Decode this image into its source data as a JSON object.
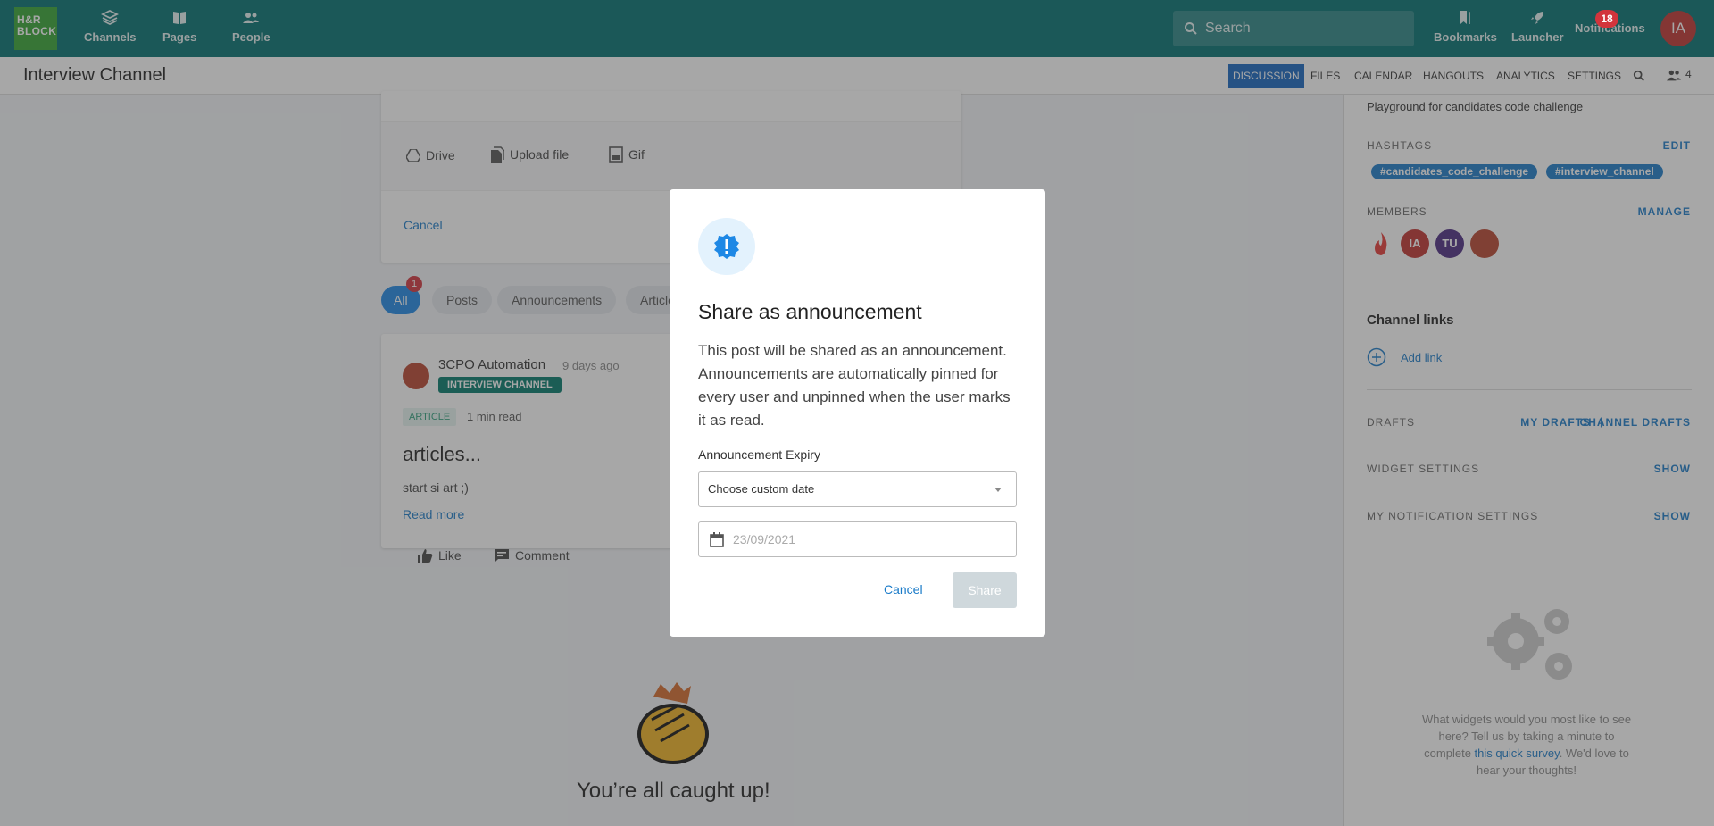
{
  "topbar": {
    "logo_text": "H&R BLOCK",
    "nav": [
      "Channels",
      "Pages",
      "People"
    ],
    "search_placeholder": "Search",
    "right": [
      "Bookmarks",
      "Launcher",
      "Notifications"
    ],
    "notifications_count": "18",
    "user_initials": "IA"
  },
  "channel": {
    "title": "Interview Channel",
    "tabs": [
      "DISCUSSION",
      "FILES",
      "CALENDAR",
      "HANGOUTS",
      "ANALYTICS",
      "SETTINGS"
    ],
    "member_count": "4"
  },
  "composer": {
    "actions": [
      "Drive",
      "Upload file",
      "Gif"
    ],
    "cancel": "Cancel"
  },
  "filters": {
    "items": [
      "All",
      "Posts",
      "Announcements",
      "Articles"
    ],
    "all_badge": "1"
  },
  "post": {
    "author": "3CPO Automation",
    "time": "9 days ago",
    "channel_tag": "INTERVIEW CHANNEL",
    "type": "ARTICLE",
    "read_time": "1 min read",
    "title": "articles...",
    "body": "start si art ;)",
    "read_more": "Read more",
    "like": "Like",
    "comment": "Comment"
  },
  "caught_up": "You’re all caught up!",
  "sidebar": {
    "description": "Playground for candidates code challenge",
    "hashtags_label": "HASHTAGS",
    "edit": "EDIT",
    "hashtags": [
      "#candidates_code_challenge",
      "#interview_channel"
    ],
    "members_label": "MEMBERS",
    "manage": "MANAGE",
    "member_initials": [
      "IA",
      "TU"
    ],
    "channel_links": "Channel links",
    "add_link": "Add link",
    "drafts": "DRAFTS",
    "my_drafts": "MY DRAFTS",
    "separator": "|",
    "channel_drafts": "CHANNEL DRAFTS",
    "widget_settings": "WIDGET SETTINGS",
    "notification_settings": "MY NOTIFICATION SETTINGS",
    "show": "SHOW",
    "survey_before": "What widgets would you most like to see here? Tell us by taking a minute to complete ",
    "survey_link": "this quick survey",
    "survey_after": ". We'd love to hear your thoughts!"
  },
  "modal": {
    "title": "Share as announcement",
    "body": "This post will be shared as an announcement. Announcements are automatically pinned for every user and unpinned when the user marks it as read.",
    "expiry_label": "Announcement Expiry",
    "select_value": "Choose custom date",
    "date_placeholder": "23/09/2021",
    "cancel": "Cancel",
    "share": "Share"
  },
  "colors": {
    "topbar": "#006f6f",
    "accent": "#1a7bc9",
    "active_tab": "#1565c0",
    "badge": "#d2343c"
  }
}
